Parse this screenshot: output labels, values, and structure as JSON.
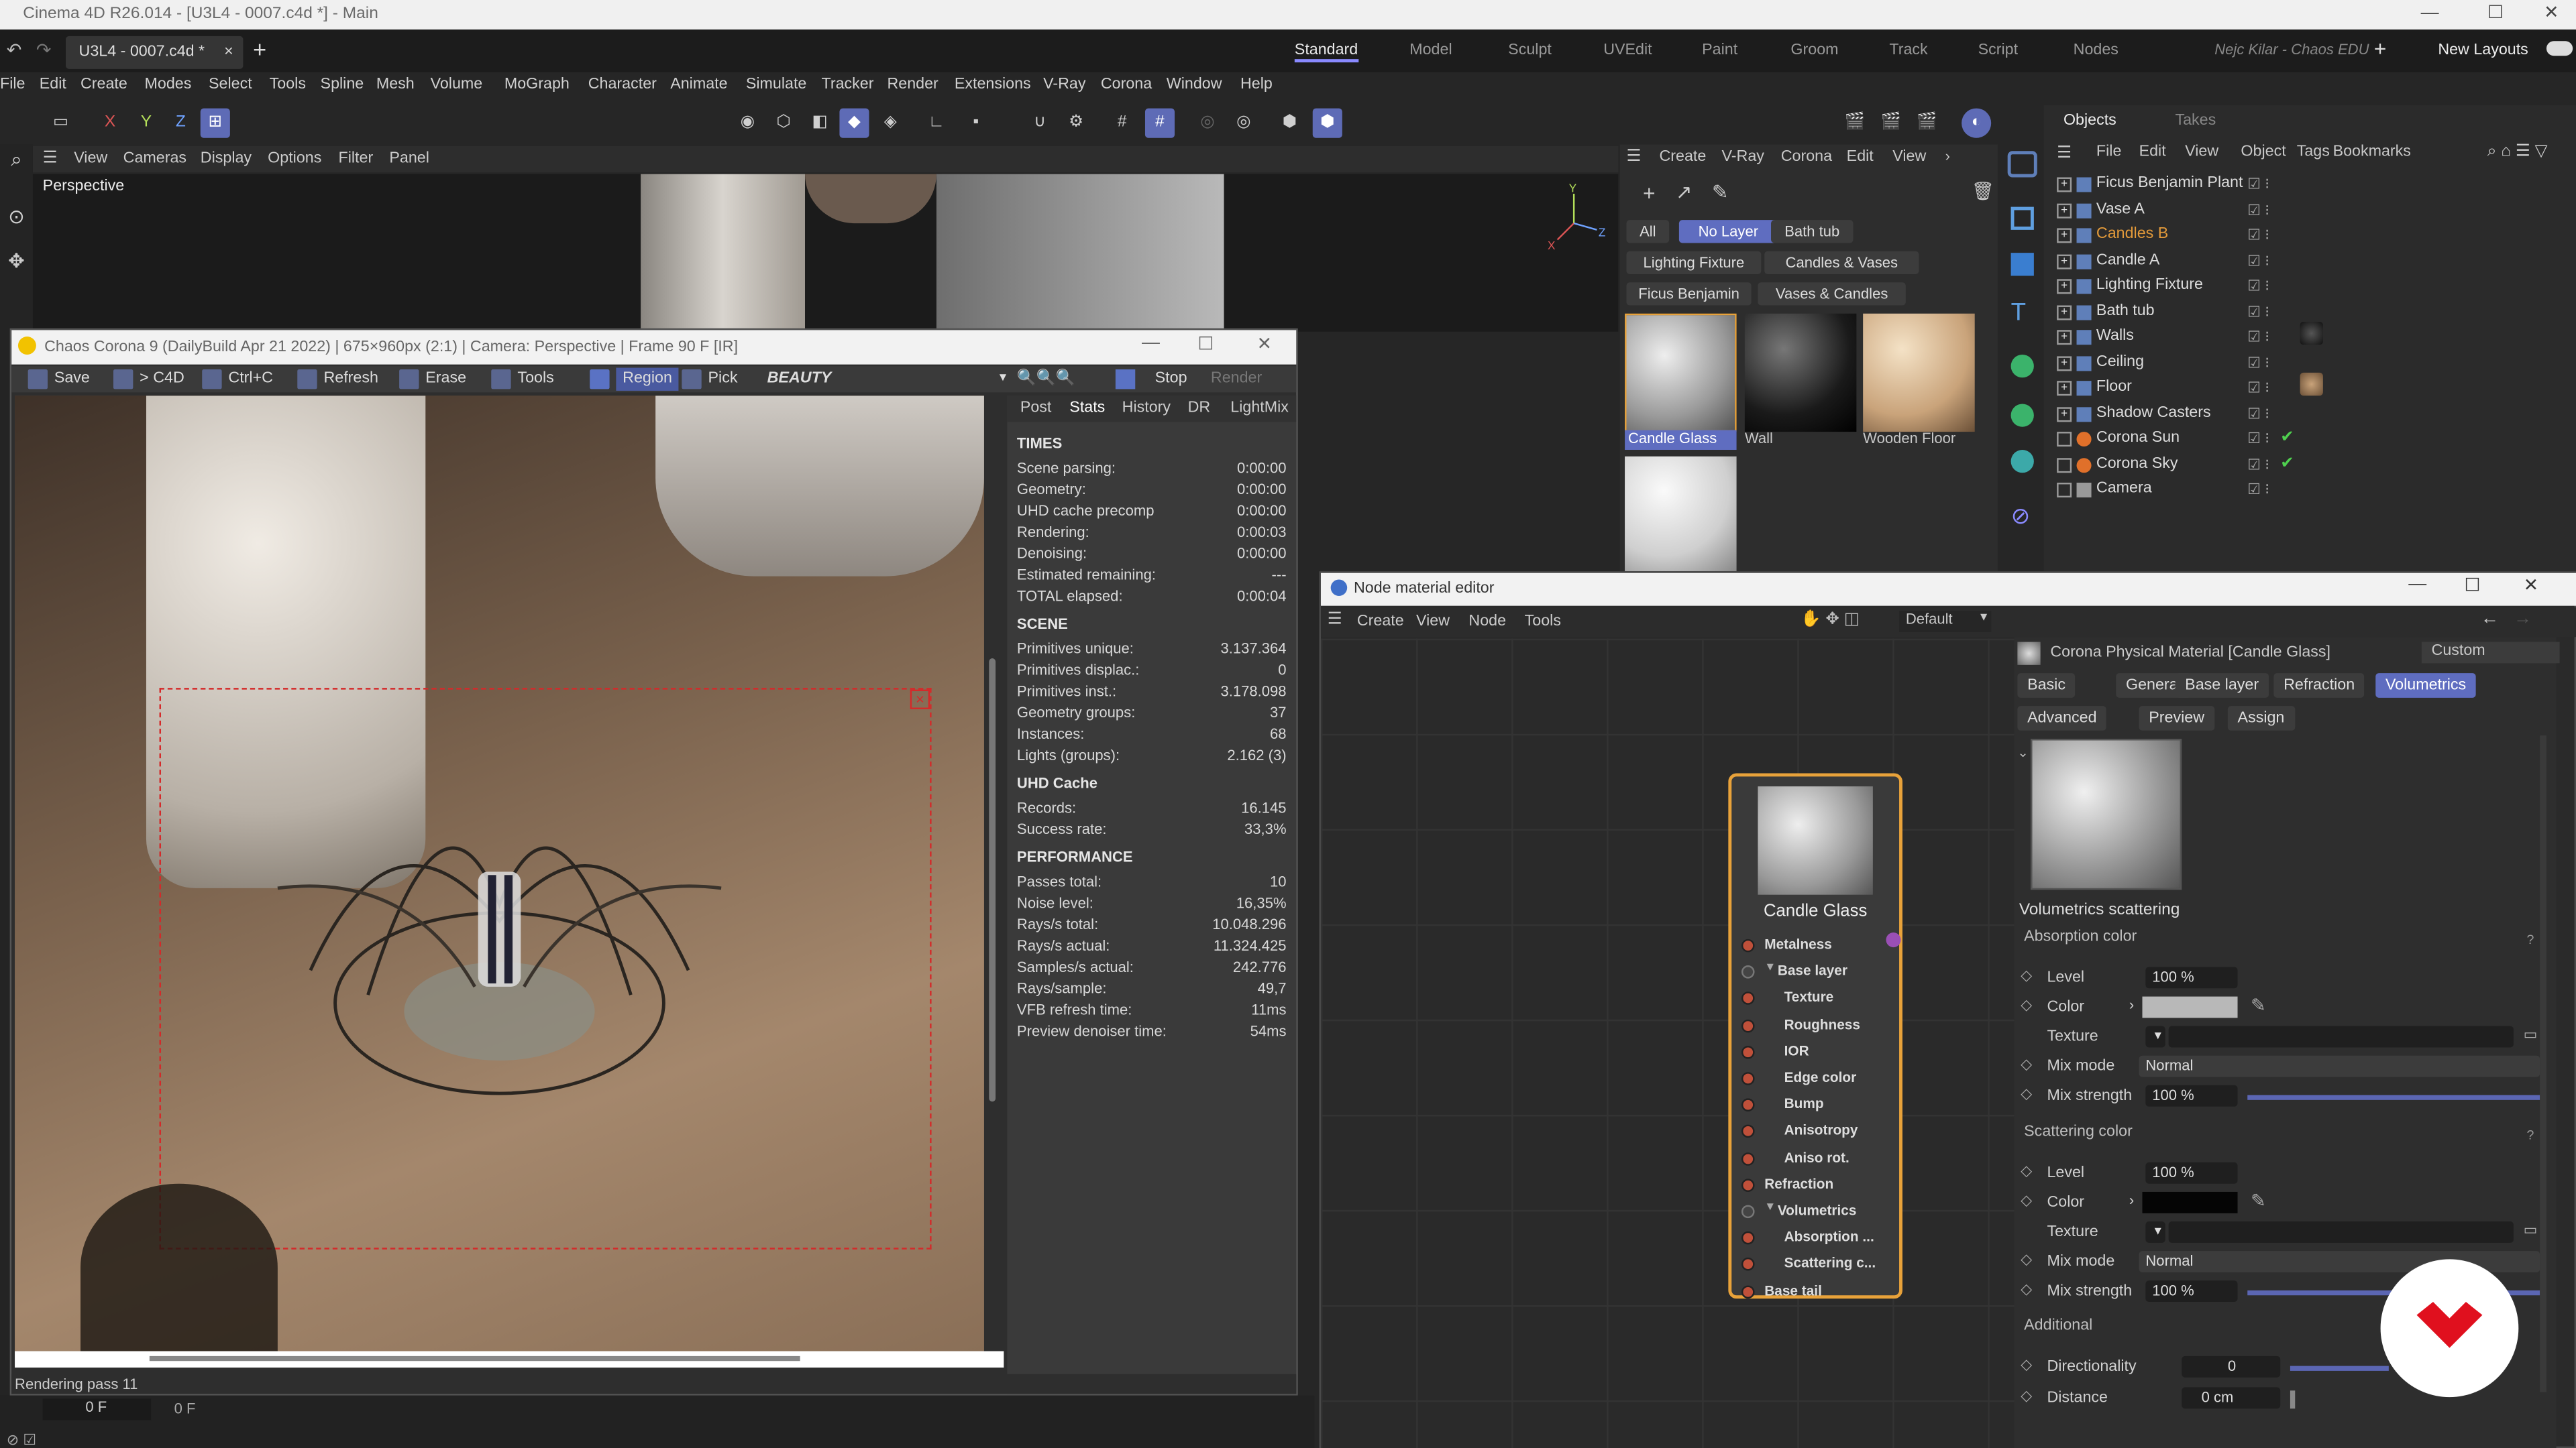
{
  "window": {
    "title": "Cinema 4D R26.014 - [U3L4 - 0007.c4d *] - Main",
    "min": "—",
    "max": "☐",
    "close": "✕"
  },
  "doc_tab": {
    "label": "U3L4 - 0007.c4d *",
    "close": "×",
    "add": "+"
  },
  "layouts": [
    "Standard",
    "Model",
    "Sculpt",
    "UVEdit",
    "Paint",
    "Groom",
    "Track",
    "Script",
    "Nodes"
  ],
  "user": "Nejc Kilar - Chaos EDU",
  "new_layouts": "New Layouts",
  "menu": [
    "File",
    "Edit",
    "Create",
    "Modes",
    "Select",
    "Tools",
    "Spline",
    "Mesh",
    "Volume",
    "MoGraph",
    "Character",
    "Animate",
    "Simulate",
    "Tracker",
    "Render",
    "Extensions",
    "V-Ray",
    "Corona",
    "Window",
    "Help"
  ],
  "axis": {
    "x": "X",
    "y": "Y",
    "z": "Z"
  },
  "viewport": {
    "menu": [
      "View",
      "Cameras",
      "Display",
      "Options",
      "Filter",
      "Panel"
    ],
    "label": "Perspective"
  },
  "vfb": {
    "title": "Chaos Corona 9 (DailyBuild Apr 21 2022) | 675×960px (2:1) | Camera: Perspective | Frame 90 F [IR]",
    "toolbar": [
      "Save",
      "> C4D",
      "Ctrl+C",
      "Refresh",
      "Erase",
      "Tools",
      "Region",
      "Pick"
    ],
    "channel": "BEAUTY",
    "stop": "Stop",
    "render": "Render",
    "tabs": [
      "Post",
      "Stats",
      "History",
      "DR",
      "LightMix"
    ],
    "sections": {
      "times": "TIMES",
      "scene": "SCENE",
      "uhd": "UHD Cache",
      "perf": "PERFORMANCE"
    },
    "times": [
      {
        "k": "Scene parsing:",
        "v": "0:00:00"
      },
      {
        "k": "Geometry:",
        "v": "0:00:00"
      },
      {
        "k": "UHD cache precomp",
        "v": "0:00:00"
      },
      {
        "k": "Rendering:",
        "v": "0:00:03"
      },
      {
        "k": "Denoising:",
        "v": "0:00:00"
      },
      {
        "k": "Estimated remaining:",
        "v": "---"
      },
      {
        "k": "TOTAL elapsed:",
        "v": "0:00:04"
      }
    ],
    "scene": [
      {
        "k": "Primitives unique:",
        "v": "3.137.364"
      },
      {
        "k": "Primitives displac.:",
        "v": "0"
      },
      {
        "k": "Primitives inst.:",
        "v": "3.178.098"
      },
      {
        "k": "Geometry groups:",
        "v": "37"
      },
      {
        "k": "Instances:",
        "v": "68"
      },
      {
        "k": "Lights (groups):",
        "v": "2.162 (3)"
      }
    ],
    "uhd": [
      {
        "k": "Records:",
        "v": "16.145"
      },
      {
        "k": "Success rate:",
        "v": "33,3%"
      }
    ],
    "perf": [
      {
        "k": "Passes total:",
        "v": "10"
      },
      {
        "k": "Noise level:",
        "v": "16,35%"
      },
      {
        "k": "Rays/s total:",
        "v": "10.048.296"
      },
      {
        "k": "Rays/s actual:",
        "v": "11.324.425"
      },
      {
        "k": "Samples/s actual:",
        "v": "242.776"
      },
      {
        "k": "Rays/sample:",
        "v": "49,7"
      },
      {
        "k": "VFB refresh time:",
        "v": "11ms"
      },
      {
        "k": "Preview denoiser time:",
        "v": "54ms"
      }
    ],
    "status": "Rendering pass 11"
  },
  "timeline": {
    "a": "0 F",
    "b": "0 F"
  },
  "materials": {
    "menu": [
      "Create",
      "V-Ray",
      "Corona",
      "Edit",
      "View"
    ],
    "filters": [
      "All",
      "No Layer",
      "Bath tub",
      "Lighting Fixture",
      "Candles & Vases",
      "Ficus Benjamin",
      "Vases & Candles"
    ],
    "items": [
      "Candle Glass",
      "Wall",
      "Wooden Floor"
    ]
  },
  "objects": {
    "tabs": [
      "Objects",
      "Takes"
    ],
    "menu": [
      "File",
      "Edit",
      "View",
      "Object",
      "Tags",
      "Bookmarks"
    ],
    "rows": [
      "Ficus Benjamin Plant",
      "Vase A",
      "Candles B",
      "Candle A",
      "Lighting Fixture",
      "Bath tub",
      "Walls",
      "Ceiling",
      "Floor",
      "Shadow Casters",
      "Corona Sun",
      "Corona Sky",
      "Camera"
    ]
  },
  "nme": {
    "title": "Node material editor",
    "menu": [
      "Create",
      "View",
      "Node",
      "Tools"
    ],
    "preset": "Default",
    "node_title": "Candle Glass",
    "ports": [
      {
        "label": "Metalness",
        "indent": 0
      },
      {
        "label": "Base layer",
        "indent": 0
      },
      {
        "label": "Texture",
        "indent": 1
      },
      {
        "label": "Roughness",
        "indent": 1
      },
      {
        "label": "IOR",
        "indent": 1
      },
      {
        "label": "Edge color",
        "indent": 1
      },
      {
        "label": "Bump",
        "indent": 1
      },
      {
        "label": "Anisotropy",
        "indent": 1
      },
      {
        "label": "Aniso rot.",
        "indent": 1
      },
      {
        "label": "Refraction",
        "indent": 0
      },
      {
        "label": "Volumetrics",
        "indent": 0
      },
      {
        "label": "Absorption ...",
        "indent": 1
      },
      {
        "label": "Scattering c...",
        "indent": 1
      },
      {
        "label": "Base tail",
        "indent": 0
      }
    ]
  },
  "attr": {
    "material": "Corona Physical Material [Candle Glass]",
    "mode": "Custom",
    "tabs": [
      "Basic",
      "General",
      "Base layer",
      "Refraction",
      "Volumetrics",
      "Advanced",
      "Preview",
      "Assign"
    ],
    "section": "Volumetrics scattering",
    "absorption": "Absorption color",
    "scattering": "Scattering color",
    "additional": "Additional",
    "labels": {
      "level": "Level",
      "color": "Color",
      "texture": "Texture",
      "mix_mode": "Mix mode",
      "mix_strength": "Mix strength",
      "directionality": "Directionality",
      "distance": "Distance"
    },
    "abs_level": "100 %",
    "abs_mix_mode": "Normal",
    "abs_mix_strength": "100 %",
    "sc_level": "100 %",
    "sc_mix_mode": "Normal",
    "sc_mix_strength": "100 %",
    "directionality": "0",
    "distance": "0 cm",
    "help": "?"
  }
}
